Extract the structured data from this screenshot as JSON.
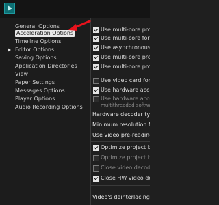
{
  "nav": {
    "items": [
      {
        "label": "General Options"
      },
      {
        "label": "Acceleration Options"
      },
      {
        "label": "Timeline Options"
      },
      {
        "label": "Editor Options"
      },
      {
        "label": "Saving Options"
      },
      {
        "label": "Application Directories"
      },
      {
        "label": "View"
      },
      {
        "label": "Paper Settings"
      },
      {
        "label": "Messages Options"
      },
      {
        "label": "Player Options"
      },
      {
        "label": "Audio Recording Options"
      }
    ]
  },
  "right": {
    "opts": [
      {
        "label": "Use multi-core proce",
        "checked": true,
        "disabled": false
      },
      {
        "label": "Use multi-core for vi",
        "checked": true,
        "disabled": false
      },
      {
        "label": "Use asynchronous vi",
        "checked": true,
        "disabled": false
      },
      {
        "label": "Use multi-core proce",
        "checked": true,
        "disabled": false
      },
      {
        "label": "Use multi-core proce",
        "checked": true,
        "disabled": false
      },
      {
        "label": "Use video card for H",
        "checked": false,
        "disabled": false
      },
      {
        "label": "Use hardware accele",
        "checked": true,
        "disabled": false
      },
      {
        "label": "Use hardware accele",
        "checked": false,
        "disabled": true
      },
      {
        "label": "Optimize project befi",
        "checked": true,
        "disabled": false
      },
      {
        "label": "Optimize project befi",
        "checked": false,
        "disabled": true
      },
      {
        "label": "Close video decoder",
        "checked": false,
        "disabled": true
      },
      {
        "label": "Close HW video deco",
        "checked": true,
        "disabled": false
      }
    ],
    "opt7_line2": "multithreaded softwa",
    "hw_decoder_type": "Hardware decoder type",
    "min_resolution": "Minimum resolution for H",
    "video_preread": "Use video pre-reading:",
    "deinterlacing": "Video's deinterlacing ho"
  },
  "colors": {
    "accent": "#0d6f73",
    "arrow": "#e8121c",
    "selected_bg": "#e9e9e9"
  },
  "icons": {
    "top": "play-icon"
  }
}
